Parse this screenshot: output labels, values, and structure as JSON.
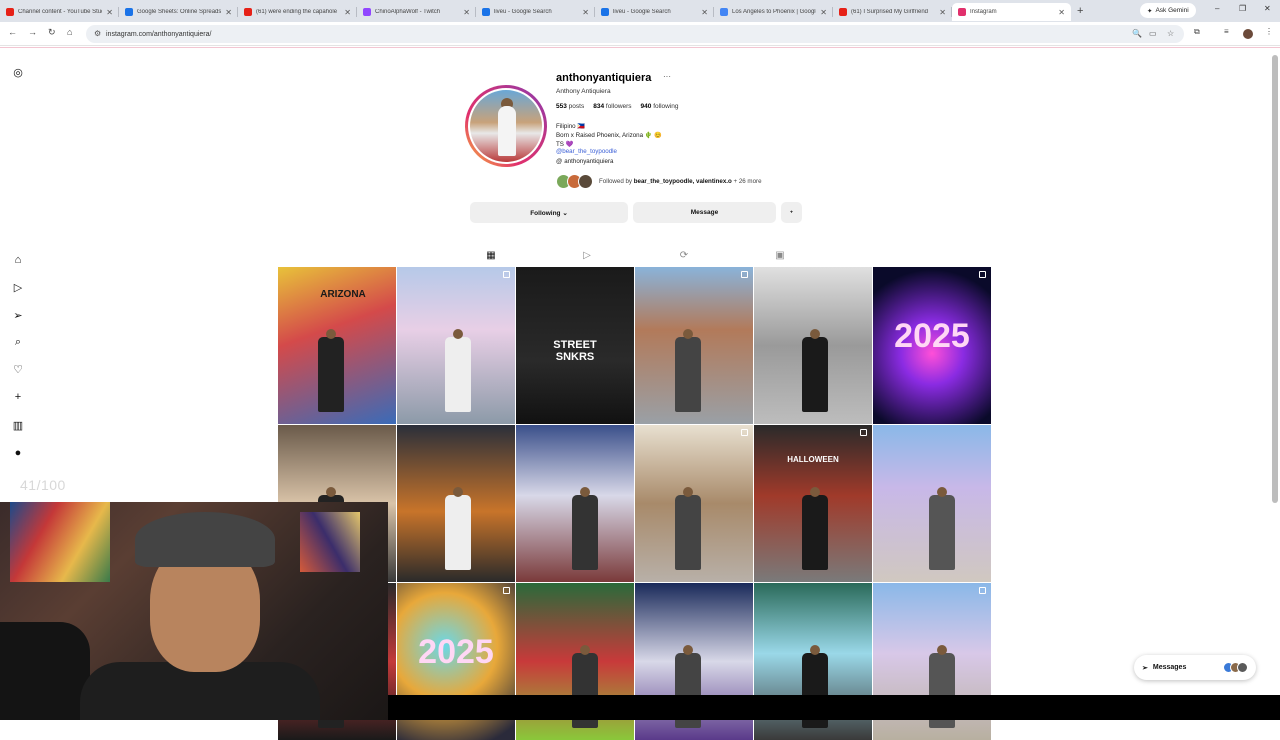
{
  "browser": {
    "tabs": [
      {
        "title": "Channel content - YouTube Studio",
        "color": "#e62117"
      },
      {
        "title": "Google Sheets: Online Spreadsheets",
        "color": "#1a73e8"
      },
      {
        "title": "(61) were ending the capahole",
        "color": "#e62117"
      },
      {
        "title": "ChinoAlphaWolf - Twitch",
        "color": "#9146ff"
      },
      {
        "title": "liveu - Google Search",
        "color": "#1a73e8"
      },
      {
        "title": "liveu - Google Search",
        "color": "#1a73e8"
      },
      {
        "title": "Los Angeles to Phoenix | Google",
        "color": "#4285f4"
      },
      {
        "title": "(61) I Surprised My Girlfriend",
        "color": "#e62117"
      },
      {
        "title": "Instagram",
        "color": "#e1306c",
        "active": true
      }
    ],
    "ask_gemini": "Ask Gemini",
    "url": "instagram.com/anthonyantiquiera/"
  },
  "profile": {
    "username": "anthonyantiquiera",
    "full_name": "Anthony Antiquiera",
    "posts": "553",
    "posts_label": "posts",
    "followers": "834",
    "followers_label": "followers",
    "following": "940",
    "following_label": "following",
    "bio_lines": [
      "Filipino 🇵🇭",
      "Born x Raised Phoenix, Arizona 🌵 😊",
      "TS 💜"
    ],
    "bio_link": "@bear_the_toypoodle",
    "threads_handle": "anthonyantiquiera",
    "followed_by_prefix": "Followed by",
    "followed_by_names": "bear_the_toypoodle, valentinex.o",
    "followed_by_suffix": "+ 26 more",
    "following_button": "Following ⌄",
    "message_button": "Message"
  },
  "posts": [
    {
      "bg": "linear-gradient(160deg,#e8c23a 0%,#d44a4a 40%,#3a6bb8 100%)",
      "overlay": "ARIZONA"
    },
    {
      "bg": "linear-gradient(180deg,#b6c9e8 0%,#e8cfe6 40%,#8c9aa8 100%)",
      "overlay": ""
    },
    {
      "bg": "linear-gradient(180deg,#1a1a1a 0%,#2a2a2a 60%,#111 100%)",
      "overlay": "STREET SNKRS"
    },
    {
      "bg": "linear-gradient(180deg,#8ab3d9 0%,#b27a5a 40%,#9aa0a6 100%)",
      "overlay": ""
    },
    {
      "bg": "linear-gradient(180deg,#e0e0e0 0%,#9a9a9a 50%,#bdbdbd 100%)",
      "overlay": ""
    },
    {
      "bg": "radial-gradient(circle at 50% 55%,#ff4fd8 0%,#8a2be2 30%,#0a0a2a 80%)",
      "overlay": "2025"
    },
    {
      "bg": "linear-gradient(180deg,#6a5a4a 0%,#d9c3a8 50%,#3a3a3a 100%)",
      "overlay": ""
    },
    {
      "bg": "linear-gradient(180deg,#2a2f3a 0%,#c8742a 55%,#2a2a2a 100%)",
      "overlay": ""
    },
    {
      "bg": "linear-gradient(180deg,#3a4f8a 0%,#d8d8e8 45%,#7a3a3a 100%)",
      "overlay": ""
    },
    {
      "bg": "linear-gradient(180deg,#e8e0d0 0%,#a88a6a 50%,#b8b0a8 100%)",
      "overlay": ""
    },
    {
      "bg": "linear-gradient(180deg,#2a2a2a 0%,#a03a2a 45%,#7a7a7a 100%)",
      "overlay": "HALLOWEEN"
    },
    {
      "bg": "linear-gradient(180deg,#8ab8e8 0%,#c8b8e8 40%,#d0c8c0 100%)",
      "overlay": ""
    },
    {
      "bg": "linear-gradient(180deg,#2a2a2a 0%,#c43a3a 50%,#1a1a1a 100%)",
      "overlay": ""
    },
    {
      "bg": "radial-gradient(circle at 40% 40%,#6ad8e8 0%,#e8a83a 45%,#2a2a3a 90%)",
      "overlay": "2025"
    },
    {
      "bg": "linear-gradient(180deg,#2a6a3a 0%,#c83a3a 50%,#8ac83a 100%)",
      "overlay": ""
    },
    {
      "bg": "linear-gradient(180deg,#1a2a5a 0%,#d8d8e8 50%,#5a3a8a 100%)",
      "overlay": ""
    },
    {
      "bg": "linear-gradient(180deg,#2a6a5a 0%,#9ad8e8 45%,#3a3a3a 100%)",
      "overlay": ""
    },
    {
      "bg": "linear-gradient(180deg,#8ab8e8 0%,#d8c8e8 45%,#b8b0a0 100%)",
      "overlay": ""
    }
  ],
  "overlay": {
    "counter": "41/100",
    "messages_label": "Messages"
  }
}
